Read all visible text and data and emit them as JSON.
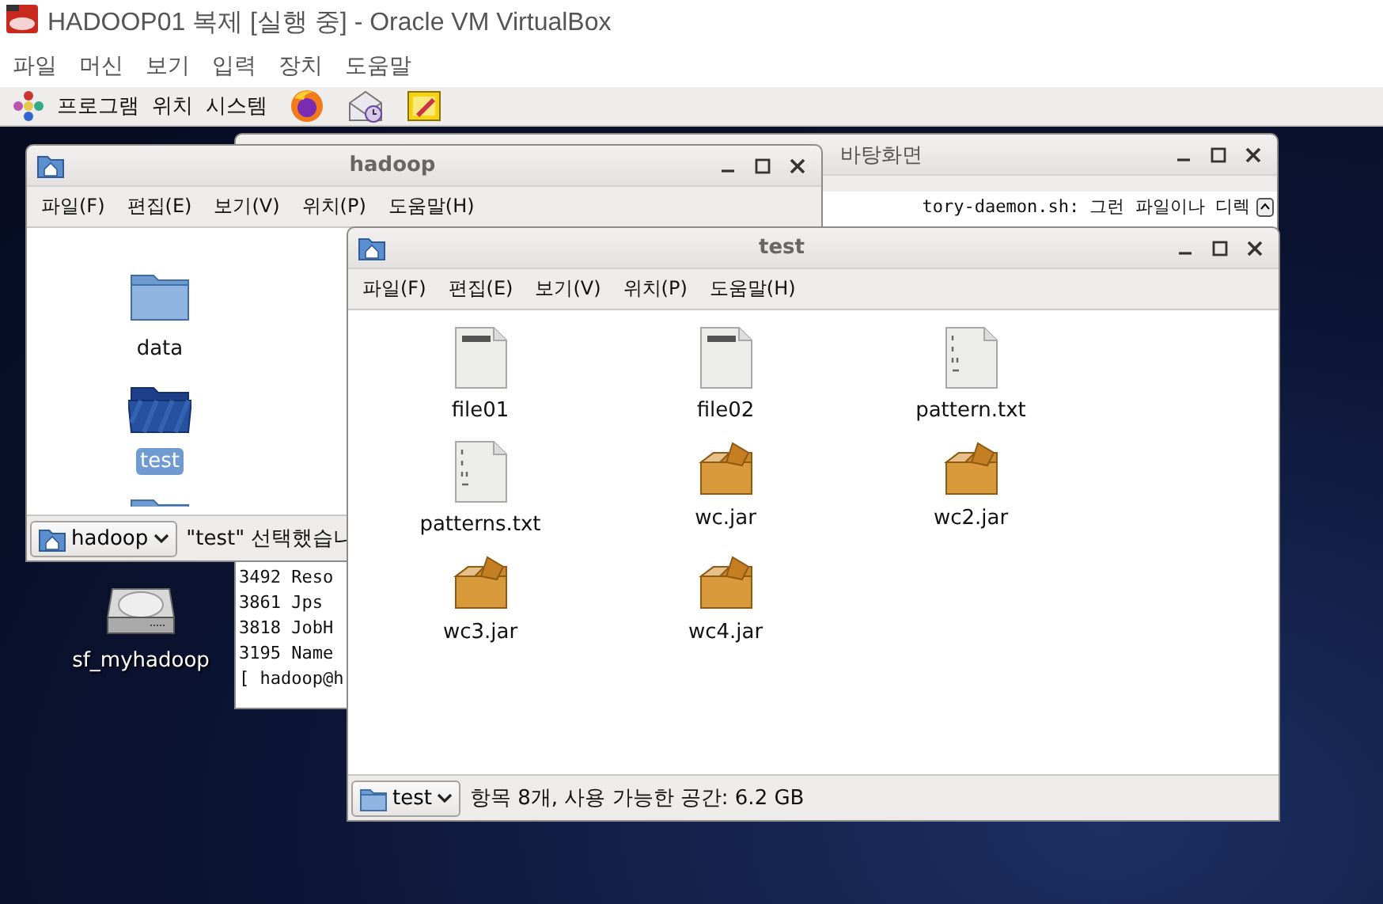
{
  "vbox": {
    "title": "HADOOP01 복제 [실행 중] - Oracle VM VirtualBox",
    "menu": [
      "파일",
      "머신",
      "보기",
      "입력",
      "장치",
      "도움말"
    ]
  },
  "panel": {
    "menus": [
      "프로그램",
      "위치",
      "시스템"
    ],
    "launchers": [
      {
        "kind": "firefox"
      },
      {
        "kind": "mail"
      },
      {
        "kind": "notes"
      }
    ]
  },
  "desktop_icons": [
    {
      "label": "sf_myhadoop",
      "kind": "drive"
    }
  ],
  "terminal": {
    "title": "바탕화면",
    "top_line": "tory-daemon.sh: 그런 파일이나 디렉",
    "lines": [
      "3492 Reso",
      "3861 Jps",
      "3818 JobH",
      "3195 Name",
      "[ hadoop@h"
    ]
  },
  "hadoop_window": {
    "title": "hadoop",
    "menu": [
      "파일(F)",
      "편집(E)",
      "보기(V)",
      "위치(P)",
      "도움말(H)"
    ],
    "items": [
      {
        "label": "data",
        "selected": false
      },
      {
        "label": "test",
        "selected": true
      }
    ],
    "location": "hadoop",
    "status": "\"test\" 선택했습니"
  },
  "test_window": {
    "title": "test",
    "menu": [
      "파일(F)",
      "편집(E)",
      "보기(V)",
      "위치(P)",
      "도움말(H)"
    ],
    "files": [
      {
        "label": "file01",
        "kind": "hello"
      },
      {
        "label": "file02",
        "kind": "hello"
      },
      {
        "label": "pattern.txt",
        "kind": "text"
      },
      {
        "label": "patterns.txt",
        "kind": "text"
      },
      {
        "label": "wc.jar",
        "kind": "jar"
      },
      {
        "label": "wc2.jar",
        "kind": "jar"
      },
      {
        "label": "wc3.jar",
        "kind": "jar"
      },
      {
        "label": "wc4.jar",
        "kind": "jar"
      }
    ],
    "location": "test",
    "status": "항목 8개, 사용 가능한 공간: 6.2 GB"
  }
}
